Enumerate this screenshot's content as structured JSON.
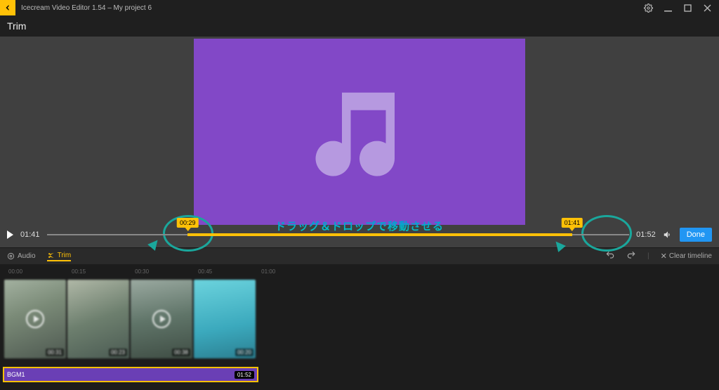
{
  "app": {
    "title": "Icecream Video Editor 1.54  –  My project 6"
  },
  "header": {
    "mode": "Trim"
  },
  "preview": {
    "annotation": "ドラッグ＆ドロップで移動させる"
  },
  "playbar": {
    "current_time": "01:41",
    "total_time": "01:52",
    "done_label": "Done",
    "trim_start": {
      "label": "00:29",
      "pct": 24.2
    },
    "trim_end": {
      "label": "01:41",
      "pct": 90.2
    }
  },
  "tabs": {
    "audio": "Audio",
    "trim": "Trim",
    "clear": "Clear timeline"
  },
  "timeline": {
    "ruler": [
      "00:00",
      "00:15",
      "00:30",
      "00:45",
      "01:00"
    ],
    "clips": [
      {
        "thumb": "a",
        "duration": "00:31"
      },
      {
        "thumb": "b",
        "duration": "00:23"
      },
      {
        "thumb": "c",
        "duration": "00:38"
      },
      {
        "thumb": "d",
        "duration": "00:20"
      }
    ],
    "audio_clip": {
      "name": "BGM1",
      "duration": "01:52"
    }
  }
}
